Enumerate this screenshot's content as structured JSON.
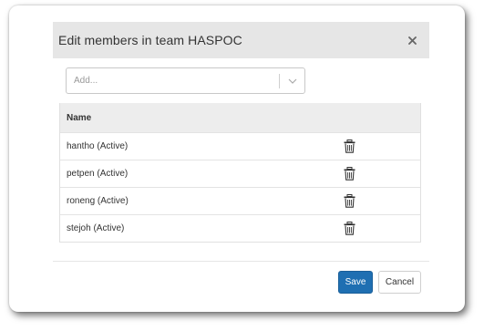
{
  "dialog": {
    "title": "Edit members in team HASPOC",
    "close_icon": "close-icon"
  },
  "add": {
    "placeholder": "Add...",
    "chevron_icon": "chevron-down-icon"
  },
  "table": {
    "header": "Name",
    "rows": [
      {
        "name": "hantho (Active)",
        "icon": "trash-icon"
      },
      {
        "name": "petpen (Active)",
        "icon": "trash-icon"
      },
      {
        "name": "roneng (Active)",
        "icon": "trash-icon"
      },
      {
        "name": "stejoh (Active)",
        "icon": "trash-icon"
      }
    ]
  },
  "footer": {
    "save_label": "Save",
    "cancel_label": "Cancel"
  },
  "colors": {
    "primary": "#1f6fb2",
    "header_bg": "#e6e6e6"
  }
}
